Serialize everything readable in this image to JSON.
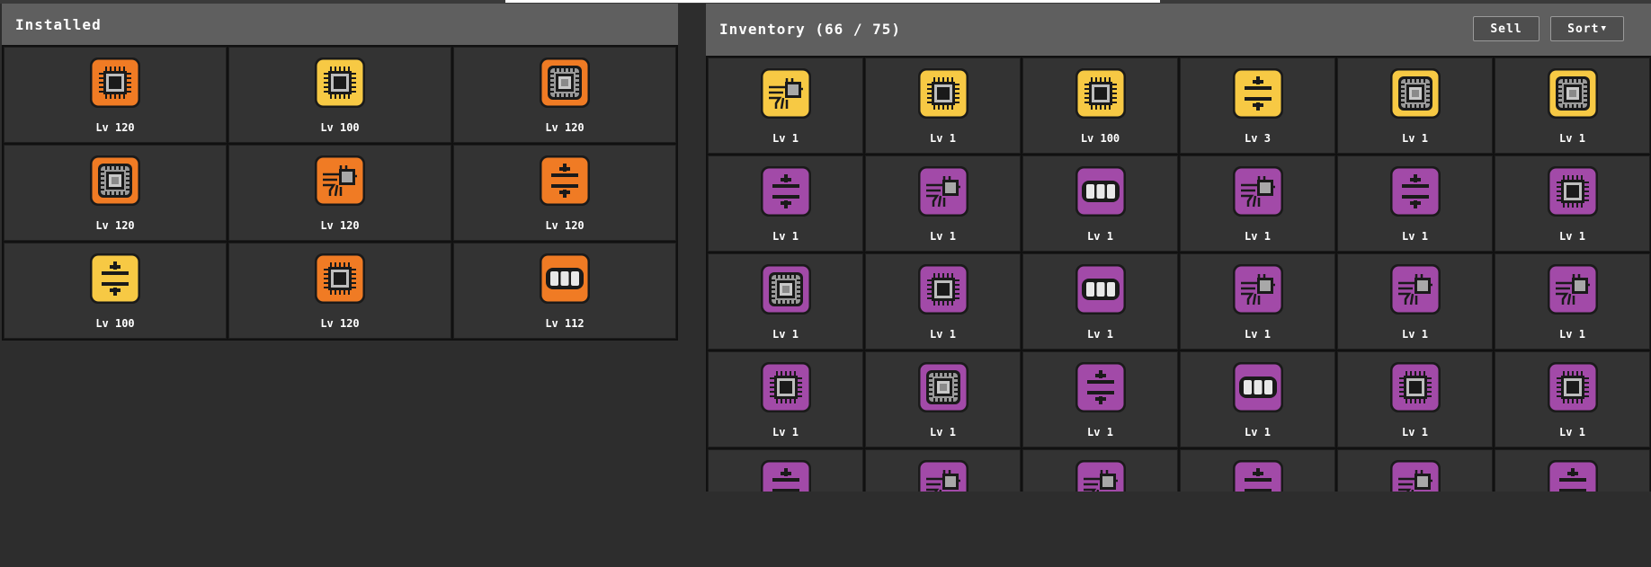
{
  "installed": {
    "title": "Installed",
    "items": [
      {
        "icon": "cpu-icon",
        "tier": "orange",
        "level": "Lv 120"
      },
      {
        "icon": "cpu-icon",
        "tier": "yellow",
        "level": "Lv 100"
      },
      {
        "icon": "square-chip-icon",
        "tier": "orange",
        "level": "Lv 120"
      },
      {
        "icon": "square-chip-icon",
        "tier": "orange",
        "level": "Lv 120"
      },
      {
        "icon": "circuit-chip-icon",
        "tier": "orange",
        "level": "Lv 120"
      },
      {
        "icon": "capacitor-icon",
        "tier": "orange",
        "level": "Lv 120"
      },
      {
        "icon": "capacitor-icon",
        "tier": "yellow",
        "level": "Lv 100"
      },
      {
        "icon": "cpu-icon",
        "tier": "orange",
        "level": "Lv 120"
      },
      {
        "icon": "battery-icon",
        "tier": "orange",
        "level": "Lv 112"
      }
    ]
  },
  "inventory": {
    "title": "Inventory (66 / 75)",
    "sell_label": "Sell",
    "sort_label": "Sort",
    "items": [
      {
        "icon": "circuit-chip-icon",
        "tier": "yellow",
        "level": "Lv 1"
      },
      {
        "icon": "cpu-icon",
        "tier": "yellow",
        "level": "Lv 1"
      },
      {
        "icon": "cpu-icon",
        "tier": "yellow",
        "level": "Lv 100"
      },
      {
        "icon": "capacitor-icon",
        "tier": "yellow",
        "level": "Lv 3"
      },
      {
        "icon": "square-chip-icon",
        "tier": "yellow",
        "level": "Lv 1"
      },
      {
        "icon": "square-chip-icon",
        "tier": "yellow",
        "level": "Lv 1"
      },
      {
        "icon": "capacitor-icon",
        "tier": "purple",
        "level": "Lv 1"
      },
      {
        "icon": "circuit-chip-icon",
        "tier": "purple",
        "level": "Lv 1"
      },
      {
        "icon": "battery-icon",
        "tier": "purple",
        "level": "Lv 1"
      },
      {
        "icon": "circuit-chip-icon",
        "tier": "purple",
        "level": "Lv 1"
      },
      {
        "icon": "capacitor-icon",
        "tier": "purple",
        "level": "Lv 1"
      },
      {
        "icon": "cpu-icon",
        "tier": "purple",
        "level": "Lv 1"
      },
      {
        "icon": "square-chip-icon",
        "tier": "purple",
        "level": "Lv 1"
      },
      {
        "icon": "cpu-icon",
        "tier": "purple",
        "level": "Lv 1"
      },
      {
        "icon": "battery-icon",
        "tier": "purple",
        "level": "Lv 1"
      },
      {
        "icon": "circuit-chip-icon",
        "tier": "purple",
        "level": "Lv 1"
      },
      {
        "icon": "circuit-chip-icon",
        "tier": "purple",
        "level": "Lv 1"
      },
      {
        "icon": "circuit-chip-icon",
        "tier": "purple",
        "level": "Lv 1"
      },
      {
        "icon": "cpu-icon",
        "tier": "purple",
        "level": "Lv 1"
      },
      {
        "icon": "square-chip-icon",
        "tier": "purple",
        "level": "Lv 1"
      },
      {
        "icon": "capacitor-icon",
        "tier": "purple",
        "level": "Lv 1"
      },
      {
        "icon": "battery-icon",
        "tier": "purple",
        "level": "Lv 1"
      },
      {
        "icon": "cpu-icon",
        "tier": "purple",
        "level": "Lv 1"
      },
      {
        "icon": "cpu-icon",
        "tier": "purple",
        "level": "Lv 1"
      },
      {
        "icon": "capacitor-icon",
        "tier": "purple",
        "level": ""
      },
      {
        "icon": "circuit-chip-icon",
        "tier": "purple",
        "level": ""
      },
      {
        "icon": "circuit-chip-icon",
        "tier": "purple",
        "level": ""
      },
      {
        "icon": "capacitor-icon",
        "tier": "purple",
        "level": ""
      },
      {
        "icon": "circuit-chip-icon",
        "tier": "purple",
        "level": ""
      },
      {
        "icon": "capacitor-icon",
        "tier": "purple",
        "level": ""
      }
    ]
  },
  "tier_colors": {
    "orange": "#f07b24",
    "yellow": "#f7c944",
    "purple": "#a24aa8"
  }
}
